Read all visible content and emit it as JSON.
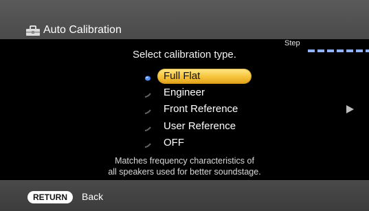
{
  "header": {
    "title": "Auto Calibration",
    "icon": "toolbox-icon"
  },
  "step": {
    "label": "Step",
    "progress_style": "dashed"
  },
  "prompt": "Select calibration type.",
  "options": [
    {
      "label": "Full Flat",
      "selected": true
    },
    {
      "label": "Engineer",
      "selected": false
    },
    {
      "label": "Front Reference",
      "selected": false
    },
    {
      "label": "User Reference",
      "selected": false
    },
    {
      "label": "OFF",
      "selected": false
    }
  ],
  "description": {
    "line1": "Matches frequency characteristics of",
    "line2": "all speakers used for better soundstage."
  },
  "footer": {
    "return_label": "RETURN",
    "back_label": "Back"
  },
  "colors": {
    "highlight": "#f5c23a",
    "bar": "#4a4a4a",
    "bullet_selected": "#4f8ff7",
    "bullet_idle": "#666666"
  }
}
